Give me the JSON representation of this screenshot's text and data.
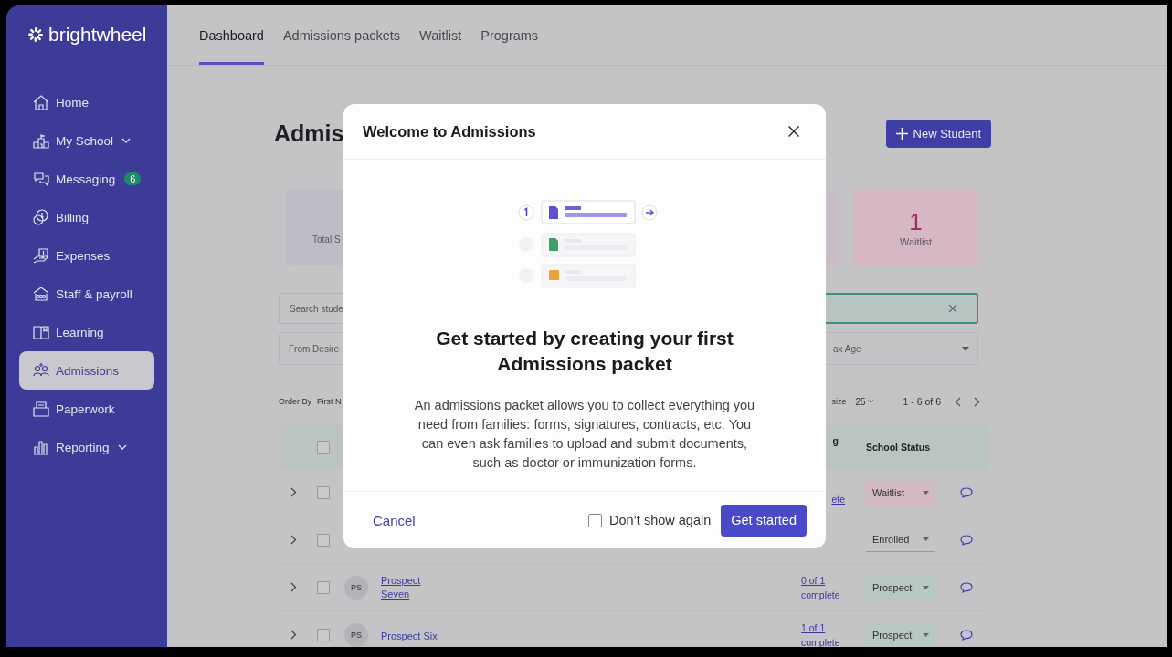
{
  "sidebar": {
    "logo": "brightwheel",
    "items": [
      {
        "label": "Home",
        "selected": false,
        "has_caret": false
      },
      {
        "label": "My School",
        "selected": false,
        "has_caret": true
      },
      {
        "label": "Messaging",
        "selected": false,
        "has_caret": false,
        "badge": "6"
      },
      {
        "label": "Billing",
        "selected": false,
        "has_caret": false
      },
      {
        "label": "Expenses",
        "selected": false,
        "has_caret": false
      },
      {
        "label": "Staff & payroll",
        "selected": false,
        "has_caret": false
      },
      {
        "label": "Learning",
        "selected": false,
        "has_caret": false
      },
      {
        "label": "Admissions",
        "selected": true,
        "has_caret": false
      },
      {
        "label": "Paperwork",
        "selected": false,
        "has_caret": false
      },
      {
        "label": "Reporting",
        "selected": false,
        "has_caret": true
      }
    ]
  },
  "tabs": [
    {
      "label": "Dashboard",
      "selected": true
    },
    {
      "label": "Admissions packets",
      "selected": false
    },
    {
      "label": "Waitlist",
      "selected": false
    },
    {
      "label": "Programs",
      "selected": false
    }
  ],
  "page": {
    "heading": "Admis",
    "new_button": "New Student",
    "stats": [
      {
        "kind": "total",
        "label": "Total S"
      },
      {
        "kind": "blank"
      },
      {
        "kind": "waitlist",
        "value": "1",
        "label": "Waitlist"
      }
    ],
    "search": {
      "placeholder": "Search stude"
    },
    "filters": {
      "from": "From Desire",
      "max_age": "ax Age"
    },
    "order": {
      "label": "Order By",
      "value": "First N",
      "page_size_label": "size",
      "page_size": "25",
      "range": "1 - 6 of 6"
    }
  },
  "table": {
    "header": {
      "checked": false,
      "packets": "g",
      "status": "School Status"
    },
    "rows": [
      {
        "checked": false,
        "packets": "ete",
        "status": "Waitlist",
        "kind": "waitlist"
      },
      {
        "checked": false,
        "status": "Enrolled",
        "kind": "enrolled"
      },
      {
        "checked": false,
        "initials": "PS",
        "name": "Prospect Seven",
        "packets": "0 of 1 complete",
        "status": "Prospect",
        "kind": "prospect"
      },
      {
        "checked": false,
        "initials": "PS",
        "name": "Prospect Six",
        "packets": "1 of 1 complete",
        "status": "Prospect",
        "kind": "prospect"
      }
    ]
  },
  "modal": {
    "title": "Welcome to Admissions",
    "heading": "Get started by creating your first Admissions packet",
    "body": "An admissions packet allows you to collect everything you need from families: forms, signatures, contracts, etc. You can even ask families to upload and submit documents, such as doctor or immunization forms.",
    "cancel": "Cancel",
    "dont_show": {
      "label": "Don’t show again",
      "checked": false
    },
    "primary": "Get started"
  }
}
